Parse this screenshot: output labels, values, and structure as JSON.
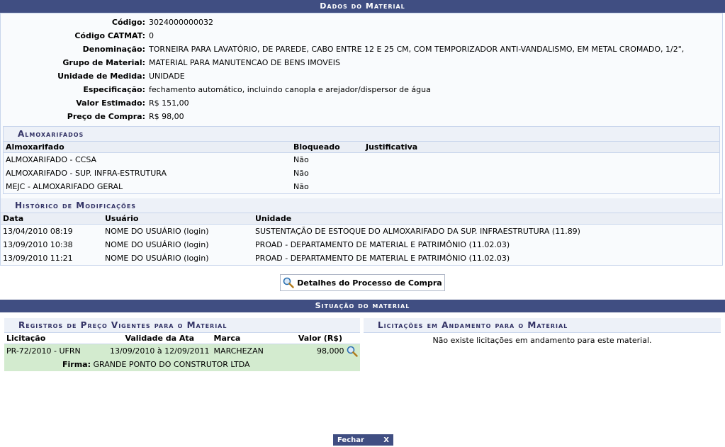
{
  "header": {
    "title": "Dados do Material"
  },
  "material": [
    {
      "label": "Código:",
      "value": "3024000000032"
    },
    {
      "label": "Código CATMAT:",
      "value": "0"
    },
    {
      "label": "Denominação:",
      "value": "TORNEIRA PARA LAVATÓRIO, DE PAREDE, CABO ENTRE 12 E 25 CM, COM TEMPORIZADOR ANTI-VANDALISMO, EM METAL CROMADO, 1/2\","
    },
    {
      "label": "Grupo de Material:",
      "value": "MATERIAL PARA MANUTENCAO DE BENS IMOVEIS"
    },
    {
      "label": "Unidade de Medida:",
      "value": "UNIDADE"
    },
    {
      "label": "Especificação:",
      "value": "fechamento automático, incluindo canopla e arejador/dispersor de água"
    },
    {
      "label": "Valor Estimado:",
      "value": "R$ 151,00"
    },
    {
      "label": "Preço de Compra:",
      "value": "R$ 98,00"
    }
  ],
  "almox": {
    "title": "Almoxarifados",
    "headers": [
      "Almoxarifado",
      "Bloqueado",
      "Justificativa"
    ],
    "rows": [
      [
        "ALMOXARIFADO - CCSA",
        "Não",
        ""
      ],
      [
        "ALMOXARIFADO - SUP. INFRA-ESTRUTURA",
        "Não",
        ""
      ],
      [
        "MEJC - ALMOXARIFADO GERAL",
        "Não",
        ""
      ]
    ]
  },
  "historico": {
    "title": "Histórico de Modificações",
    "headers": [
      "Data",
      "Usuário",
      "Unidade"
    ],
    "rows": [
      [
        "13/04/2010 08:19",
        "NOME DO USUÁRIO (login)",
        "SUSTENTAÇÃO DE ESTOQUE DO ALMOXARIFADO DA SUP. INFRAESTRUTURA (11.89)"
      ],
      [
        "13/09/2010 10:38",
        "NOME DO USUÁRIO (login)",
        "PROAD - DEPARTAMENTO DE MATERIAL E PATRIMÔNIO (11.02.03)"
      ],
      [
        "13/09/2010 11:21",
        "NOME DO USUÁRIO (login)",
        "PROAD - DEPARTAMENTO DE MATERIAL E PATRIMÔNIO (11.02.03)"
      ]
    ]
  },
  "details_button": "Detalhes do Processo de Compra",
  "situacao": {
    "title": "Situação do material",
    "registros": {
      "title": "Registros de Preço Vigentes para o Material",
      "headers": [
        "Licitação",
        "Validade da Ata",
        "Marca",
        "Valor (R$)"
      ],
      "row": [
        "PR-72/2010 - UFRN",
        "13/09/2010 à 12/09/2011",
        "MARCHEZAN",
        "98,000"
      ],
      "firma_label": "Firma:",
      "firma_value": "GRANDE PONTO DO CONSTRUTOR LTDA"
    },
    "licitacoes": {
      "title": "Licitações em Andamento para o Material",
      "empty": "Não existe licitações em andamento para este material."
    }
  },
  "footer": {
    "close_label": "Fechar",
    "close_x": "X"
  }
}
